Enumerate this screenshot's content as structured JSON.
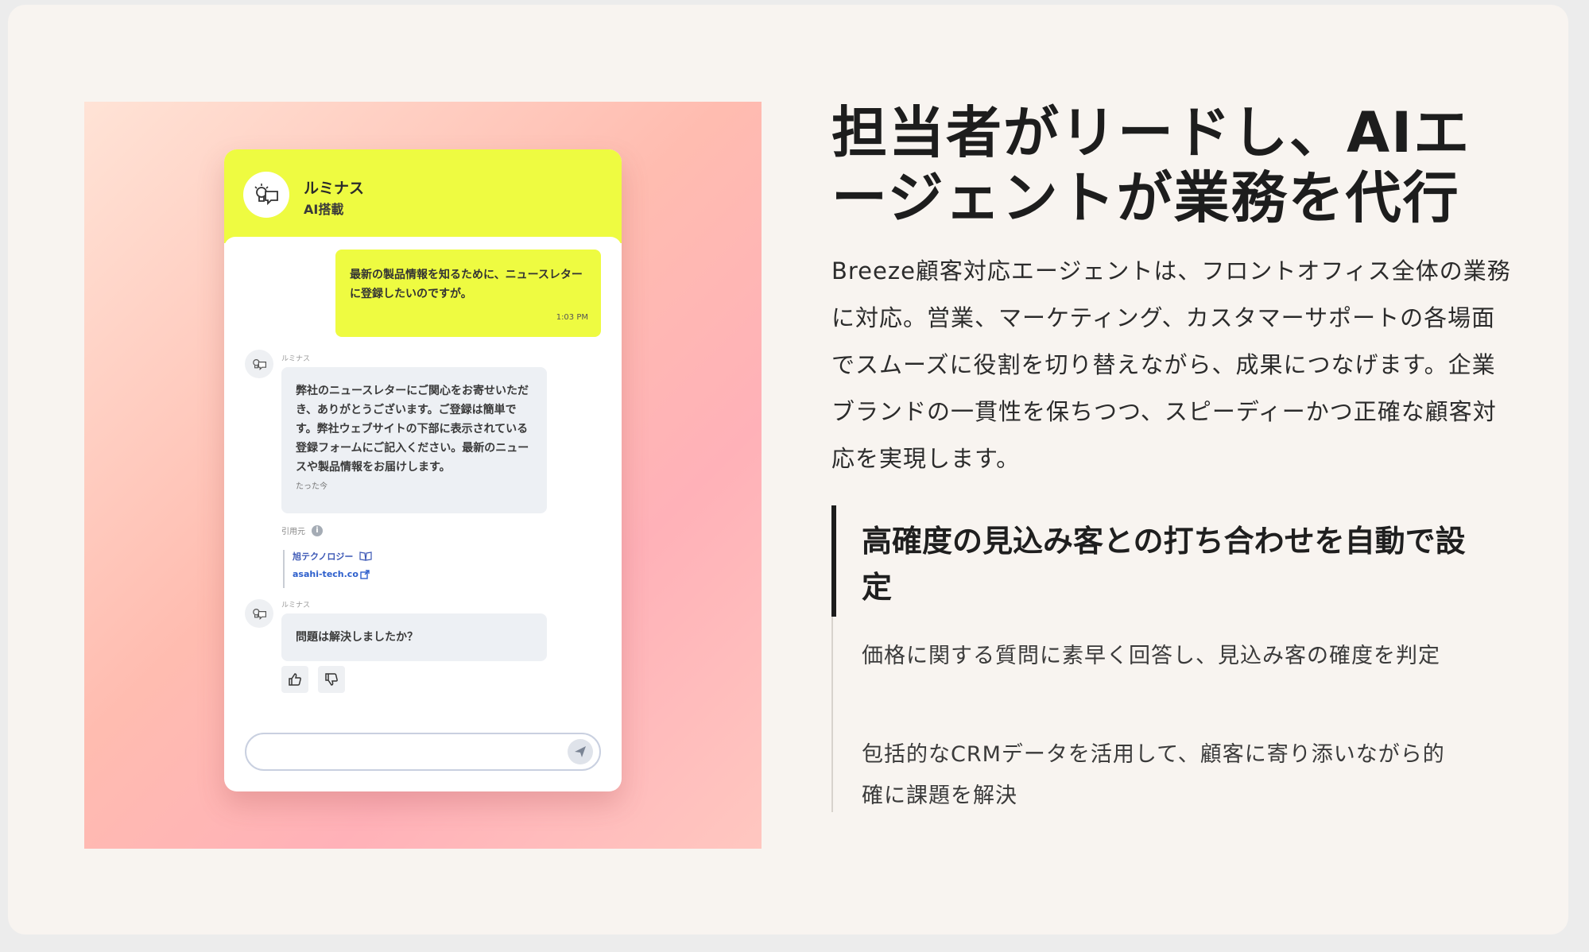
{
  "chat": {
    "header": {
      "name": "ルミナス",
      "sub": "AI搭載"
    },
    "user_message": {
      "text": "最新の製品情報を知るために、ニュースレターに登録したいのですが。",
      "time": "1:03 PM"
    },
    "bot_message_1": {
      "sender": "ルミナス",
      "text": "弊社のニュースレターにご関心をお寄せいただき、ありがとうございます。ご登録は簡単です。弊社ウェブサイトの下部に表示されている登録フォームにご記入ください。最新のニュースや製品情報をお届けします。",
      "time": "たった今"
    },
    "citation": {
      "label": "引用元",
      "source_name": "旭テクノロジー",
      "source_link": "asahi-tech.co"
    },
    "bot_message_2": {
      "sender": "ルミナス",
      "text": "問題は解決しましたか？"
    },
    "input": {
      "placeholder": ""
    },
    "icons": {
      "avatar": "lightbulb-chat-icon",
      "thumbs_up": "thumbs-up-icon",
      "thumbs_down": "thumbs-down-icon",
      "send": "send-icon"
    }
  },
  "content": {
    "title_line1": "担当者がリードし、AIエ",
    "title_line2": "ージェントが業務を代行",
    "lead": "Breeze顧客対応エージェントは、フロントオフィス全体の業務に対応。営業、マーケティング、カスタマーサポートの各場面でスムーズに役割を切り替えながら、成果につなげます。企業ブランドの一貫性を保ちつつ、スピーディーかつ正確な顧客対応を実現します。",
    "feature_title": "高確度の見込み客との打ち合わせを自動で設定",
    "feature_items": [
      "価格に関する質問に素早く回答し、見込み客の確度を判定",
      "包括的なCRMデータを活用して、顧客に寄り添いながら的確に課題を解決"
    ]
  },
  "colors": {
    "accent_yellow": "#eefb41",
    "card_bg": "#f8f4f0",
    "bubble_gray": "#edf0f4",
    "link_blue": "#2d5fcc"
  }
}
